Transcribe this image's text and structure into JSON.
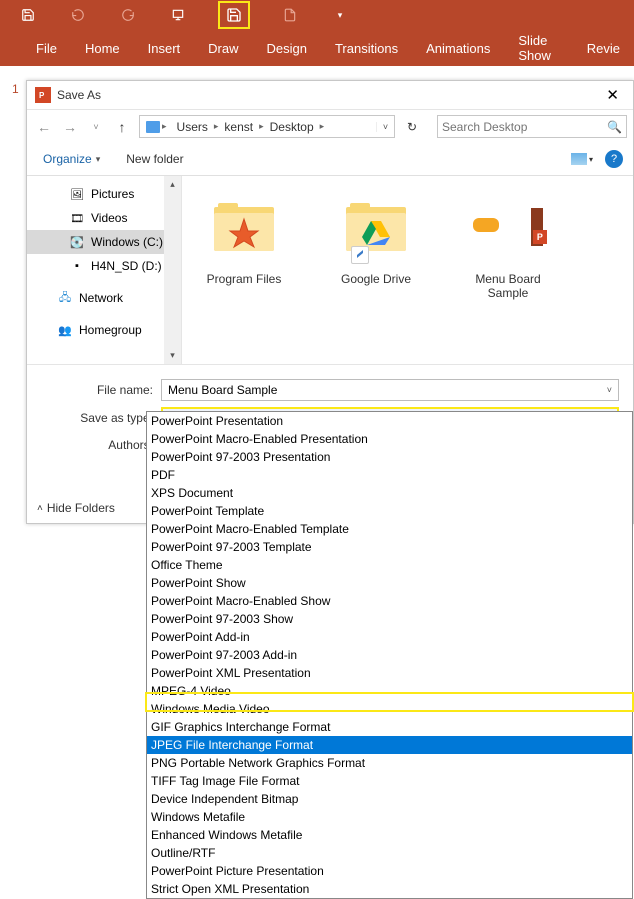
{
  "ribbon": {
    "tabs": [
      "File",
      "Home",
      "Insert",
      "Draw",
      "Design",
      "Transitions",
      "Animations",
      "Slide Show",
      "Revie"
    ]
  },
  "slide_number": "1",
  "dialog": {
    "title": "Save As",
    "path_segs": [
      "Users",
      "kenst",
      "Desktop"
    ],
    "search_placeholder": "Search Desktop",
    "organize": "Organize",
    "newfolder": "New folder",
    "help": "?",
    "tree": {
      "pictures": "Pictures",
      "videos": "Videos",
      "windowsc": "Windows (C:)",
      "h4nsd": "H4N_SD (D:)",
      "network": "Network",
      "homegroup": "Homegroup"
    },
    "files": {
      "program_files": "Program Files",
      "google_drive": "Google Drive",
      "menu_board": "Menu Board Sample"
    },
    "filename_label": "File name:",
    "filename_value": "Menu Board Sample",
    "saveas_label": "Save as type:",
    "saveas_value": "PowerPoint Presentation",
    "authors_label": "Authors:",
    "hide_folders": "Hide Folders"
  },
  "dropdown": {
    "opts": [
      "PowerPoint Presentation",
      "PowerPoint Macro-Enabled Presentation",
      "PowerPoint 97-2003 Presentation",
      "PDF",
      "XPS Document",
      "PowerPoint Template",
      "PowerPoint Macro-Enabled Template",
      "PowerPoint 97-2003 Template",
      "Office Theme",
      "PowerPoint Show",
      "PowerPoint Macro-Enabled Show",
      "PowerPoint 97-2003 Show",
      "PowerPoint Add-in",
      "PowerPoint 97-2003 Add-in",
      "PowerPoint XML Presentation",
      "MPEG-4 Video",
      "Windows Media Video",
      "GIF Graphics Interchange Format",
      "JPEG File Interchange Format",
      "PNG Portable Network Graphics Format",
      "TIFF Tag Image File Format",
      "Device Independent Bitmap",
      "Windows Metafile",
      "Enhanced Windows Metafile",
      "Outline/RTF",
      "PowerPoint Picture Presentation",
      "Strict Open XML Presentation"
    ],
    "selected_index": 18
  }
}
